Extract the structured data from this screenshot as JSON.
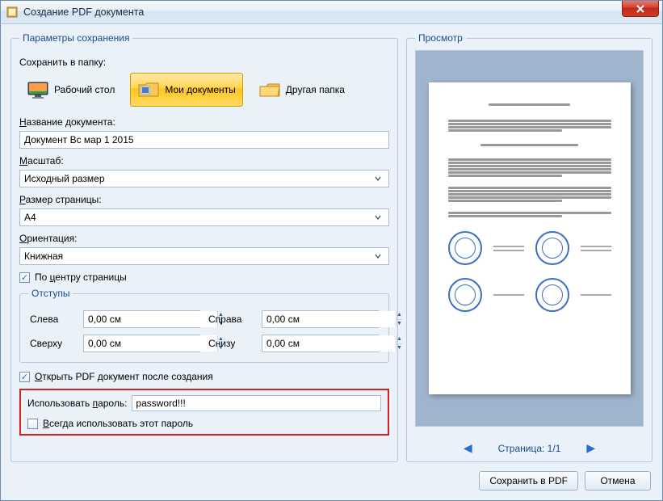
{
  "window": {
    "title": "Создание PDF документа"
  },
  "left": {
    "legend": "Параметры сохранения",
    "save_to_label": "Сохранить в папку:",
    "folders": {
      "desktop": "Рабочий стол",
      "documents": "Мои документы",
      "other": "Другая папка"
    },
    "docname_label": "Название документа:",
    "docname_value": "Документ Вс мар 1 2015",
    "scale_label": "Масштаб:",
    "scale_value": "Исходный размер",
    "pagesize_label": "Размер страницы:",
    "pagesize_value": "A4",
    "orient_label": "Ориентация:",
    "orient_value": "Книжная",
    "center_label": "По центру страницы",
    "margins": {
      "legend": "Отступы",
      "left_label": "Слева",
      "left_value": "0,00 см",
      "right_label": "Справа",
      "right_value": "0,00 см",
      "top_label": "Сверху",
      "top_value": "0,00 см",
      "bottom_label": "Снизу",
      "bottom_value": "0,00 см"
    },
    "open_after_label": "Открыть PDF документ после создания",
    "password": {
      "label": "Использовать пароль:",
      "value": "password!!!",
      "always_label": "Всегда использовать этот пароль"
    }
  },
  "right": {
    "legend": "Просмотр",
    "page_label": "Страница: 1/1"
  },
  "buttons": {
    "save": "Сохранить в PDF",
    "cancel": "Отмена"
  }
}
